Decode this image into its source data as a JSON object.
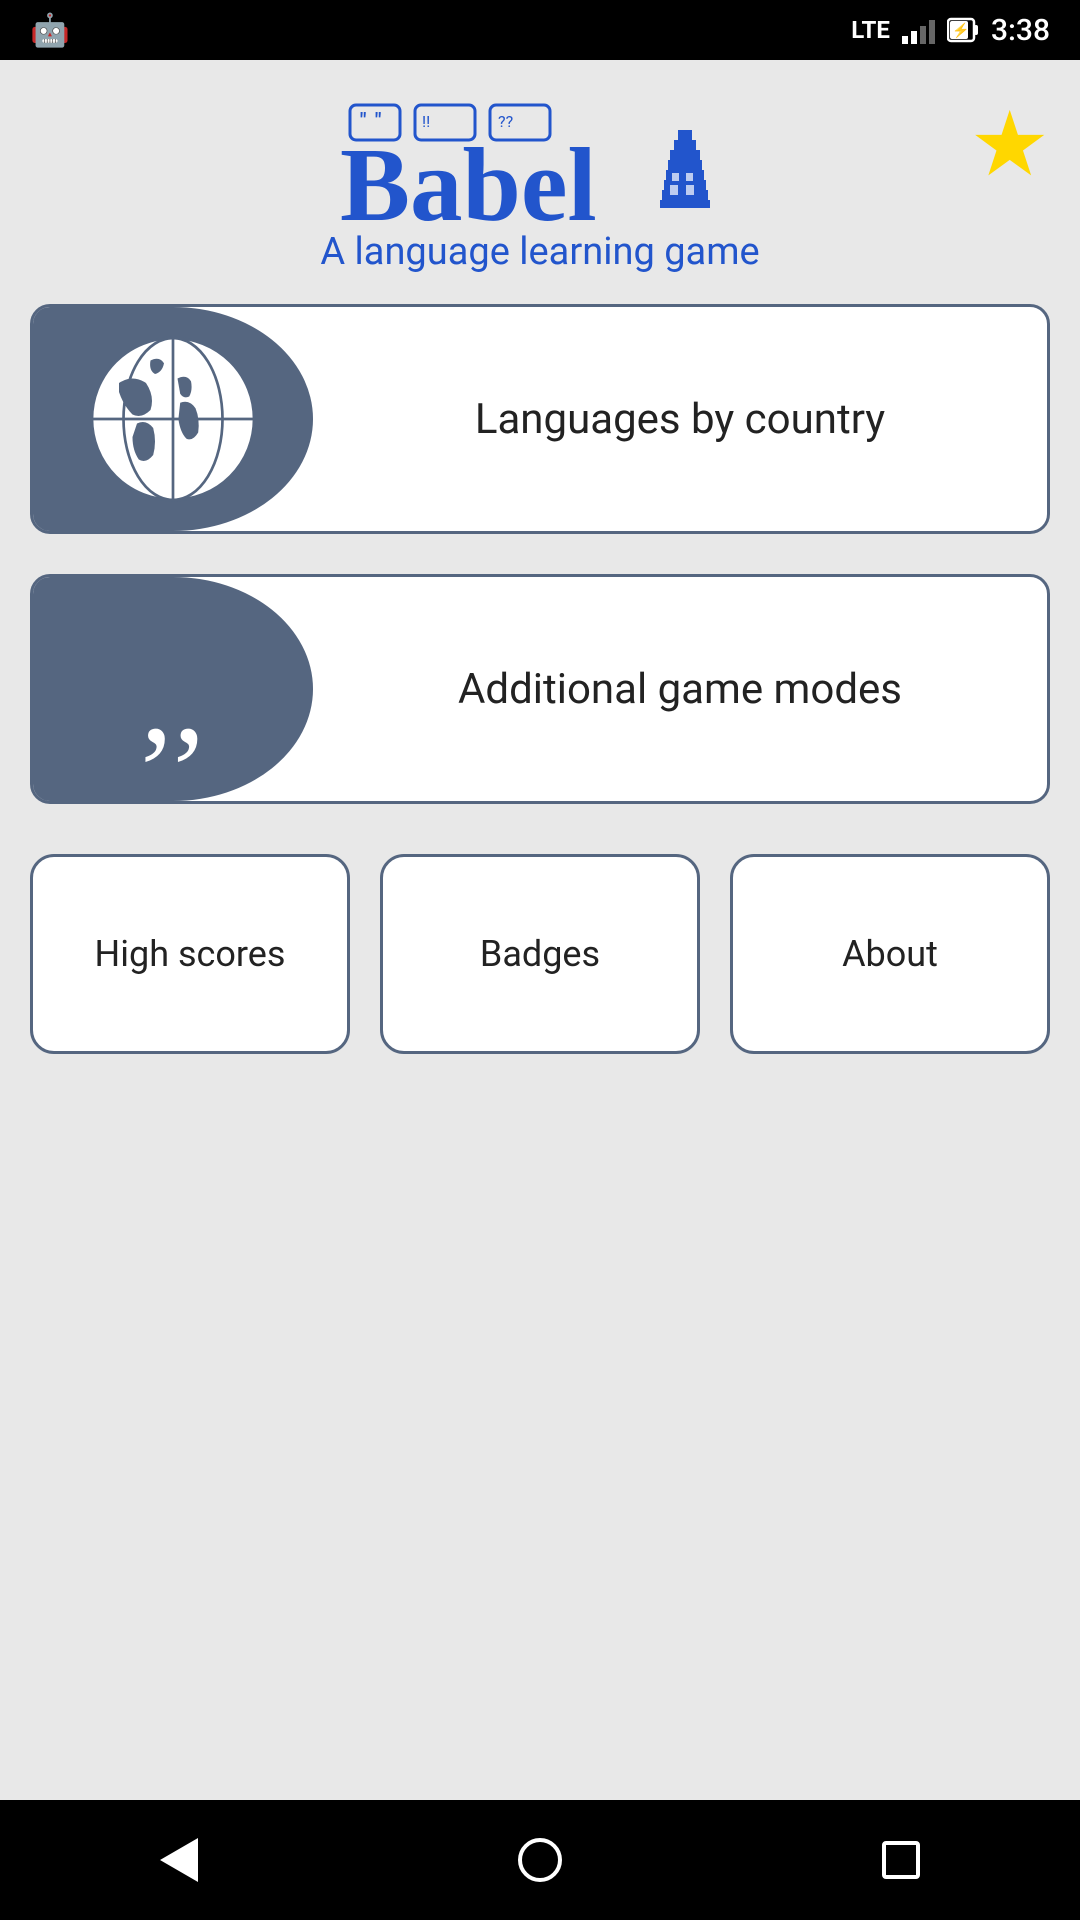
{
  "status_bar": {
    "time": "3:38",
    "lte_label": "LTE"
  },
  "header": {
    "app_title": "Babel",
    "subtitle": "A language learning game",
    "star_symbol": "★"
  },
  "buttons": {
    "languages_by_country": "Languages by country",
    "additional_game_modes": "Additional game modes",
    "high_scores": "High scores",
    "badges": "Badges",
    "about": "About"
  },
  "nav": {
    "back": "◁",
    "home": "",
    "recents": ""
  }
}
